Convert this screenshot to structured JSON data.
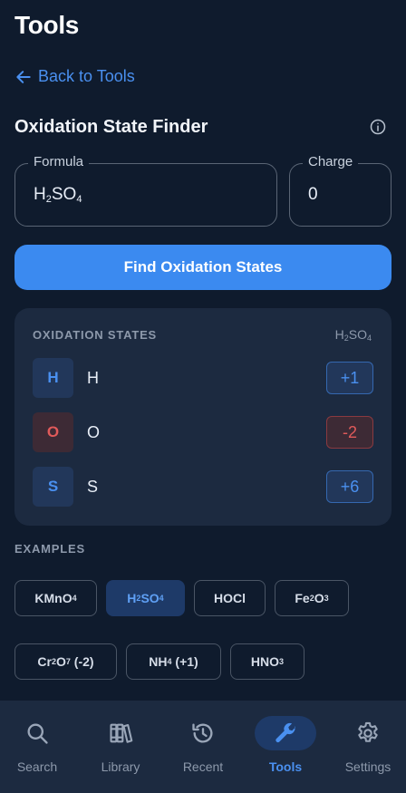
{
  "header": {
    "title": "Tools"
  },
  "back_link": {
    "label": "Back to Tools"
  },
  "section": {
    "title": "Oxidation State Finder"
  },
  "formula_field": {
    "label": "Formula",
    "value_parts": [
      "H",
      "2",
      "SO",
      "4"
    ]
  },
  "charge_field": {
    "label": "Charge",
    "value": "0"
  },
  "find_button": {
    "label": "Find Oxidation States"
  },
  "results": {
    "heading": "OXIDATION STATES",
    "formula_parts": [
      "H",
      "2",
      "SO",
      "4"
    ],
    "rows": [
      {
        "symbol": "H",
        "name": "H",
        "state": "+1",
        "tone": "blue"
      },
      {
        "symbol": "O",
        "name": "O",
        "state": "-2",
        "tone": "red"
      },
      {
        "symbol": "S",
        "name": "S",
        "state": "+6",
        "tone": "blue"
      }
    ]
  },
  "examples": {
    "heading": "EXAMPLES",
    "chips": [
      {
        "parts": [
          "KMnO",
          "4"
        ],
        "active": false
      },
      {
        "parts": [
          "H",
          "2",
          "SO",
          "4"
        ],
        "active": true
      },
      {
        "parts": [
          "HOCl"
        ],
        "active": false
      },
      {
        "parts": [
          "Fe",
          "2",
          "O",
          "3"
        ],
        "active": false
      },
      {
        "parts": [
          "Cr",
          "2",
          "O",
          "7",
          " (-2)"
        ],
        "active": false
      },
      {
        "parts": [
          "NH",
          "4",
          " (+1)"
        ],
        "active": false
      },
      {
        "parts": [
          "HNO",
          "3"
        ],
        "active": false
      }
    ]
  },
  "colors": {
    "accent": "#3b8af0",
    "blue_text": "#4a90f0",
    "blue_badge_bg": "#22375a",
    "red_text": "#e05a5a",
    "red_badge_bg": "#3d2a35"
  },
  "nav": {
    "items": [
      {
        "label": "Search",
        "icon": "search-icon",
        "active": false
      },
      {
        "label": "Library",
        "icon": "books-icon",
        "active": false
      },
      {
        "label": "Recent",
        "icon": "history-icon",
        "active": false
      },
      {
        "label": "Tools",
        "icon": "wrench-icon",
        "active": true
      },
      {
        "label": "Settings",
        "icon": "gear-icon",
        "active": false
      }
    ]
  }
}
